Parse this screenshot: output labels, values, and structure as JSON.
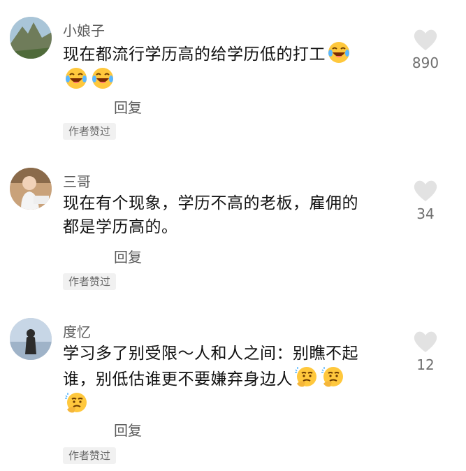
{
  "comments": [
    {
      "username": "小娘子",
      "text": "现在都流行学历高的给学历低的打工",
      "emojis": [
        "laugh-cry-emoji",
        "laugh-cry-emoji",
        "laugh-cry-emoji"
      ],
      "reply_label": "回复",
      "badge": "作者赞过",
      "likes": "890"
    },
    {
      "username": "三哥",
      "text_lines": [
        "现在有个现象，学历不高的老板，雇佣的",
        "都是学历高的。"
      ],
      "reply_label": "回复",
      "badge": "作者赞过",
      "likes": "34"
    },
    {
      "username": "度忆",
      "text_lines": [
        "学习多了别受限～人和人之间：别瞧不起",
        "谁，别低估谁更不要嫌弃身边人"
      ],
      "emojis": [
        "thinking-emoji",
        "thinking-emoji",
        "thinking-emoji"
      ],
      "reply_label": "回复",
      "badge": "作者赞过",
      "likes": "12"
    }
  ],
  "colors": {
    "heart": "#e2e2e2",
    "emoji_face": "#ffc83d",
    "badge_bg": "#f1f1f1"
  }
}
